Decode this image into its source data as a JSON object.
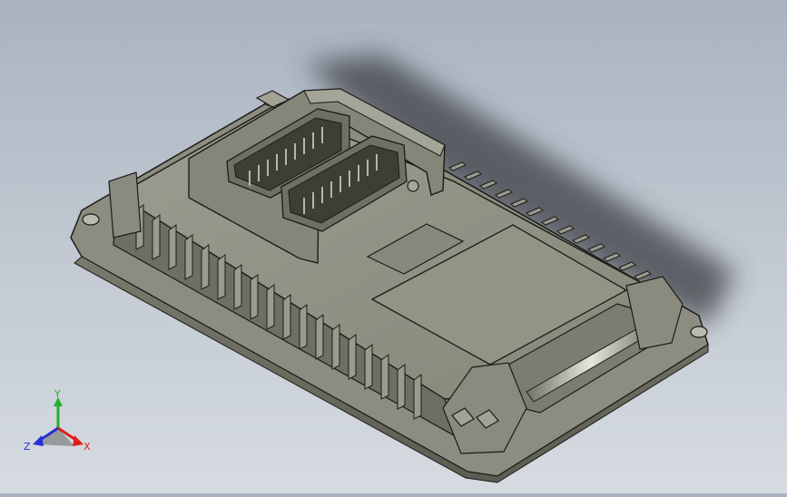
{
  "viewport": {
    "background_top": "#a9b3c0",
    "background_bottom": "#d6dbe1",
    "model_body_color": "#8f8f84",
    "model_edge_color": "#1c1c18"
  },
  "triad": {
    "x_label": "X",
    "y_label": "Y",
    "z_label": "Z",
    "x_color": "#e0201c",
    "y_color": "#22b02a",
    "z_color": "#2630d8"
  }
}
